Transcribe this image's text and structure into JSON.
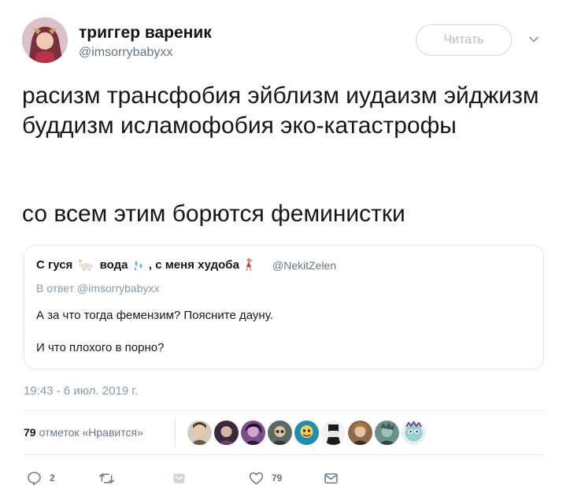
{
  "author": {
    "display_name": "триггер вареник",
    "handle": "@imsorrybabyxx",
    "follow_label": "Читать"
  },
  "tweet": {
    "paragraph_1": "расизм трансфобия эйблизм иудаизм эйджизм буддизм исламофобия эко-катастрофы",
    "paragraph_2": "со всем этим борются феминистки"
  },
  "quoted": {
    "name_part_1": "С гуся",
    "name_part_2": "вода",
    "name_part_3": ", с меня худоба",
    "handle": "@NekitZelen",
    "reply_to": "В ответ @imsorrybabyxx",
    "line_1": "А за что тогда фемензим? Поясните дауну.",
    "line_2": "И что плохого в порно?"
  },
  "timestamp": "19:43 - 6 июл. 2019 г.",
  "likes": {
    "count": "79",
    "label": "отметок «Нравится»"
  },
  "actions": {
    "reply_count": "2",
    "like_count": "79"
  },
  "colors": {
    "text": "#14171a",
    "secondary": "#657786",
    "border": "#e1e8ed"
  }
}
